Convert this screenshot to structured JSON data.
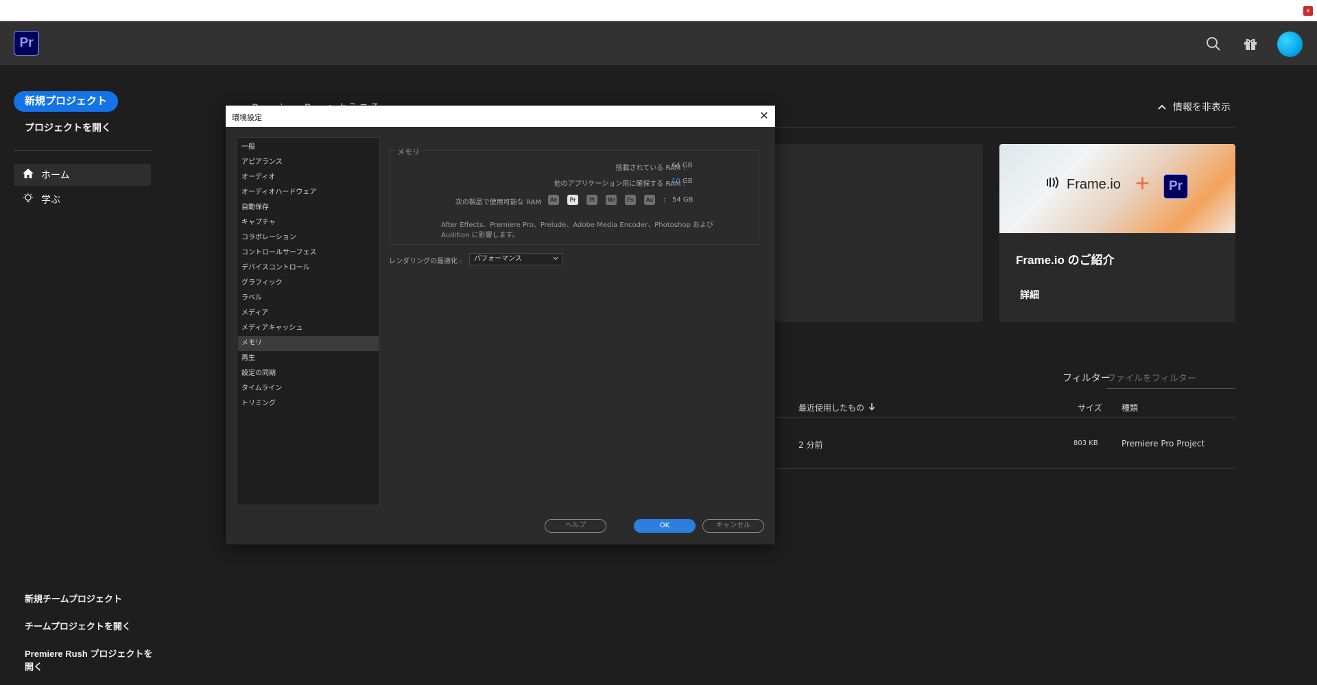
{
  "window": {
    "close_label": "x"
  },
  "appbar": {
    "logo": "Pr",
    "icons": [
      "search-icon",
      "gift-icon",
      "avatar"
    ]
  },
  "sidebar": {
    "new_project": "新規プロジェクト",
    "open_project": "プロジェクトを開く",
    "nav": [
      {
        "label": "ホーム",
        "icon": "home-icon"
      },
      {
        "label": "学ぶ",
        "icon": "lightbulb-icon"
      }
    ],
    "bottom_links": [
      "新規チームプロジェクト",
      "チームプロジェクトを開く",
      "Premiere Rush プロジェクトを開く"
    ]
  },
  "home": {
    "welcome": "Premiere Pro へようこそ",
    "hide_info": "情報を非表示",
    "card": {
      "logo_text": "Frame.io",
      "plus": "+",
      "pr_badge": "Pr",
      "title": "Frame.io のご紹介",
      "link": "詳細"
    },
    "filter": {
      "label": "フィルター",
      "placeholder": "ファイルをフィルター"
    },
    "columns": {
      "recent": "最近使用したもの",
      "size": "サイズ",
      "type": "種類"
    },
    "rows": [
      {
        "modified": "2 分前",
        "size": "803 KB",
        "type": "Premiere Pro Project"
      }
    ]
  },
  "dialog": {
    "title": "環境設定",
    "categories": [
      "一般",
      "アピアランス",
      "オーディオ",
      "オーディオハードウェア",
      "自動保存",
      "キャプチャ",
      "コラボレーション",
      "コントロールサーフェス",
      "デバイスコントロール",
      "グラフィック",
      "ラベル",
      "メディア",
      "メディアキャッシュ",
      "メモリ",
      "再生",
      "設定の同期",
      "タイムライン",
      "トリミング"
    ],
    "selected_index": 13,
    "memory": {
      "legend": "メモリ",
      "installed_label": "搭載されている RAM :",
      "installed_value": "64 GB",
      "reserved_label": "他のアプリケーション用に確保する RAM :",
      "reserved_value": "10",
      "reserved_unit": "GB",
      "available_label": "次の製品で使用可能な RAM",
      "apps": [
        "Ae",
        "Pr",
        "Pl",
        "Me",
        "Ps",
        "Au"
      ],
      "available_sep": ":",
      "available_value": "54 GB",
      "note": "After Effects、Premiere Pro、Prelude、Adobe Media Encoder、Photoshop および Audition に影響します。"
    },
    "render": {
      "label": "レンダリングの最適化 :",
      "value": "パフォーマンス"
    },
    "buttons": {
      "help": "ヘルプ",
      "ok": "OK",
      "cancel": "キャンセル"
    },
    "colors": {
      "accent": "#2c7fe0",
      "reserved_value": "#3a8ee6"
    }
  }
}
